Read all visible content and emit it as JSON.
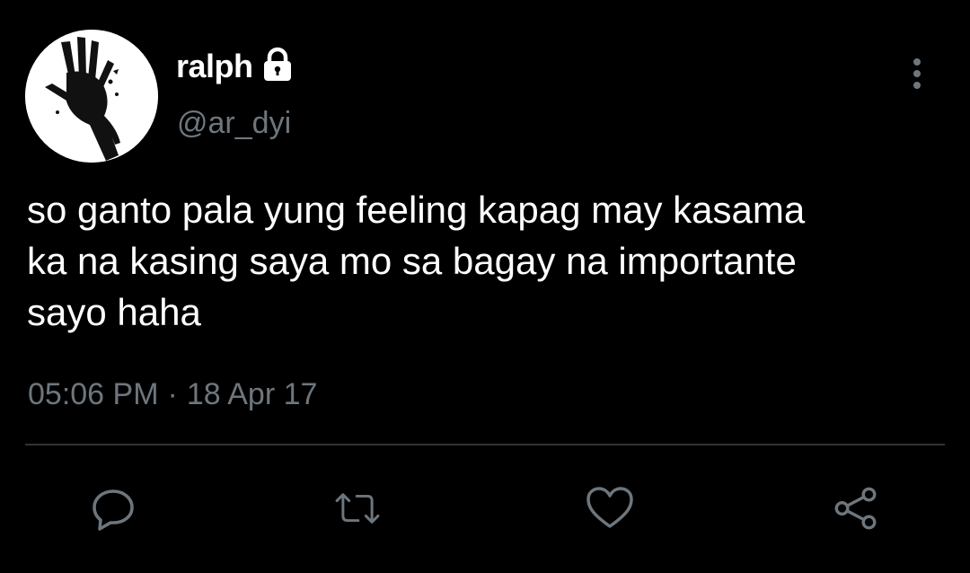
{
  "tweet": {
    "author": {
      "display_name": "ralph",
      "handle": "@ar_dyi",
      "protected_icon": "lock-icon",
      "avatar_icon": "hand-avatar"
    },
    "text": "so ganto pala yung feeling kapag may kasama\nka na kasing saya mo sa bagay na importante\nsayo haha",
    "time": "05:06 PM",
    "separator": "·",
    "date": "18 Apr 17"
  },
  "actions": [
    {
      "name": "reply",
      "icon": "reply-icon"
    },
    {
      "name": "retweet",
      "icon": "retweet-icon"
    },
    {
      "name": "like",
      "icon": "heart-icon"
    },
    {
      "name": "share",
      "icon": "share-icon"
    }
  ],
  "menu_icon": "more-vertical-icon",
  "colors": {
    "background": "#000000",
    "text": "#ffffff",
    "muted": "#6e767d",
    "divider": "#2f3336"
  }
}
